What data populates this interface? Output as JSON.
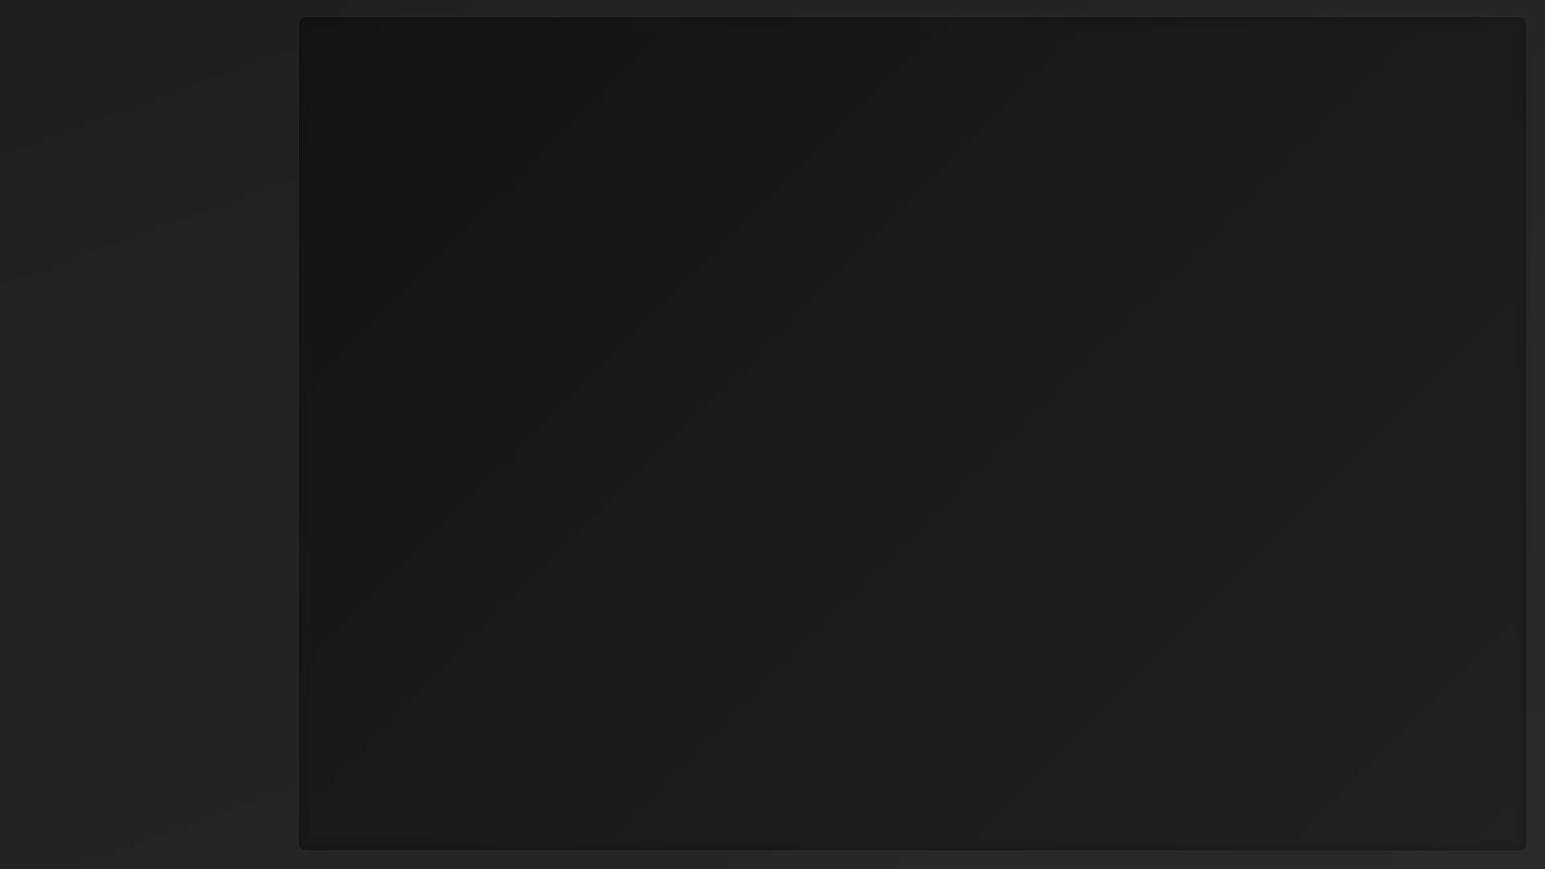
{
  "theme": {
    "background": "#232323",
    "sidebar_background": "#212121",
    "panel_background": "#1a1a1a",
    "panel_border": "#2e2e2e"
  },
  "sidebar": {
    "items": []
  },
  "main": {
    "content": []
  }
}
